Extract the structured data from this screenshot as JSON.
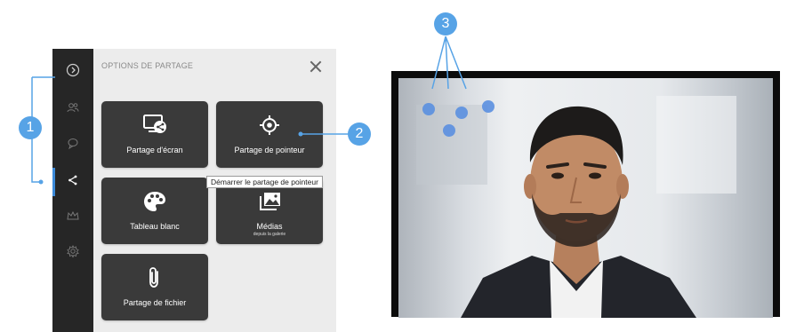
{
  "panel": {
    "title": "OPTIONS DE PARTAGE",
    "tiles": [
      {
        "label": "Partage d'écran",
        "icon": "screen-share-icon"
      },
      {
        "label": "Partage de pointeur",
        "icon": "pointer-target-icon"
      },
      {
        "label": "Tableau blanc",
        "icon": "palette-icon"
      },
      {
        "label": "Médias",
        "sublabel": "depuis la galerie",
        "icon": "media-gallery-icon"
      },
      {
        "label": "Partage de fichier",
        "icon": "paperclip-icon"
      }
    ],
    "tooltip": "Démarrer le partage de pointeur"
  },
  "rail": {
    "items": [
      {
        "icon": "expand-arrow-icon"
      },
      {
        "icon": "participants-icon"
      },
      {
        "icon": "chat-icon"
      },
      {
        "icon": "share-icon",
        "active": true
      },
      {
        "icon": "crown-icon"
      },
      {
        "icon": "settings-icon"
      }
    ]
  },
  "callouts": [
    "1",
    "2",
    "3"
  ],
  "colors": {
    "accent": "#57a3e6",
    "rail_bg": "#262626",
    "tile_bg": "#3a3a3a",
    "panel_bg": "#ececec",
    "pointer_dot": "#5a8fe0"
  }
}
